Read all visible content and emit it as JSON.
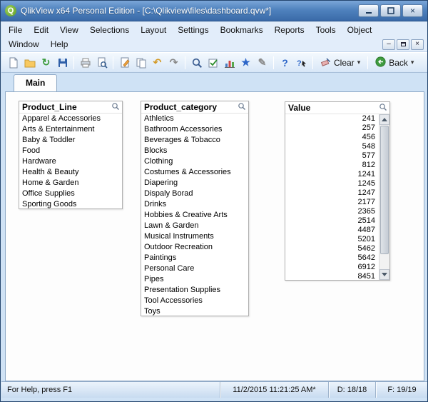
{
  "window": {
    "title": "QlikView x64 Personal Edition - [C:\\Qlikview\\files\\dashboard.qvw*]"
  },
  "menu": {
    "row1": [
      "File",
      "Edit",
      "View",
      "Selections",
      "Layout",
      "Settings",
      "Bookmarks",
      "Reports",
      "Tools",
      "Object"
    ],
    "row2": [
      "Window",
      "Help"
    ]
  },
  "toolbar": {
    "clear_label": "Clear",
    "back_label": "Back",
    "icons": [
      "new-document-icon",
      "open-folder-icon",
      "reload-icon",
      "save-icon",
      "print-icon",
      "print-preview-icon",
      "edit-script-icon",
      "copy-icon",
      "undo-icon",
      "redo-icon",
      "search-icon",
      "current-selections-icon",
      "chart-wizard-icon",
      "bookmark-star-icon",
      "design-pencil-icon",
      "help-icon",
      "context-help-icon",
      "clear-selections-icon",
      "back-arrow-icon"
    ]
  },
  "tabs": [
    {
      "label": "Main"
    }
  ],
  "listboxes": [
    {
      "title": "Product_Line",
      "items": [
        "Apparel & Accessories",
        "Arts & Entertainment",
        "Baby & Toddler",
        "Food",
        "Hardware",
        "Health & Beauty",
        "Home & Garden",
        "Office Supplies",
        "Sporting Goods"
      ]
    },
    {
      "title": "Product_category",
      "items": [
        "Athletics",
        "Bathroom Accessories",
        "Beverages & Tobacco",
        "Blocks",
        "Clothing",
        "Costumes & Accessories",
        "Diapering",
        "Dispaly Borad",
        "Drinks",
        "Hobbies & Creative Arts",
        "Lawn & Garden",
        "Musical Instruments",
        "Outdoor Recreation",
        "Paintings",
        "Personal Care",
        "Pipes",
        "Presentation Supplies",
        "Tool Accessories",
        "Toys"
      ]
    },
    {
      "title": "Value",
      "items": [
        241,
        257,
        456,
        548,
        577,
        812,
        1241,
        1245,
        1247,
        2177,
        2365,
        2514,
        4487,
        5201,
        5462,
        5642,
        6912,
        8451
      ]
    }
  ],
  "statusbar": {
    "help": "For Help, press F1",
    "timestamp": "11/2/2015 11:21:25 AM*",
    "d_counter": "D: 18/18",
    "f_counter": "F: 19/19"
  }
}
